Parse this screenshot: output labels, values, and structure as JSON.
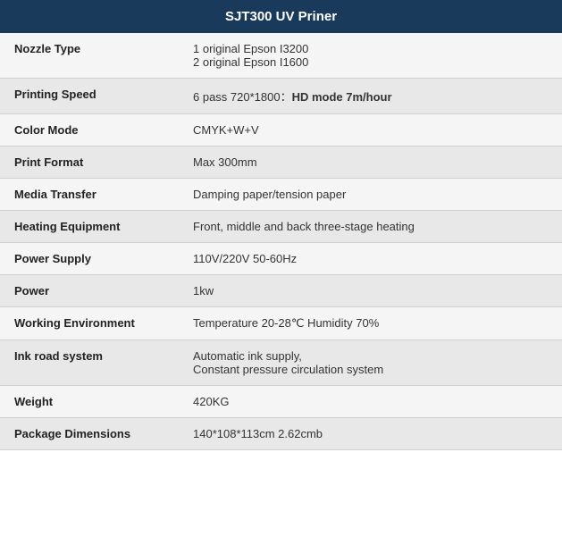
{
  "header": {
    "title": "SJT300 UV Priner"
  },
  "rows": [
    {
      "label": "Nozzle Type",
      "value": "1 original Epson I3200\n2 original Epson I1600",
      "multiline": true,
      "bold_part": ""
    },
    {
      "label": "Printing Speed",
      "value_prefix": "6 pass 720*1800：",
      "value_bold": "HD mode 7m/hour",
      "multiline": false,
      "mixed_bold": true
    },
    {
      "label": "Color Mode",
      "value": "CMYK+W+V",
      "multiline": false
    },
    {
      "label": "Print Format",
      "value": "Max 300mm",
      "multiline": false
    },
    {
      "label": "Media Transfer",
      "value": "Damping paper/tension paper",
      "multiline": false
    },
    {
      "label": "Heating Equipment",
      "value": "Front, middle and back three-stage heating",
      "multiline": false
    },
    {
      "label": "Power Supply",
      "value": "110V/220V 50-60Hz",
      "multiline": false
    },
    {
      "label": "Power",
      "value": "1kw",
      "multiline": false
    },
    {
      "label": "Working Environment",
      "value": "Temperature 20-28℃ Humidity 70%",
      "multiline": false
    },
    {
      "label": "Ink road system",
      "value": "Automatic ink supply,\nConstant pressure circulation system",
      "multiline": true
    },
    {
      "label": "Weight",
      "value": "420KG",
      "multiline": false
    },
    {
      "label": "Package Dimensions",
      "value": "140*108*113cm 2.62cmb",
      "multiline": false
    }
  ]
}
